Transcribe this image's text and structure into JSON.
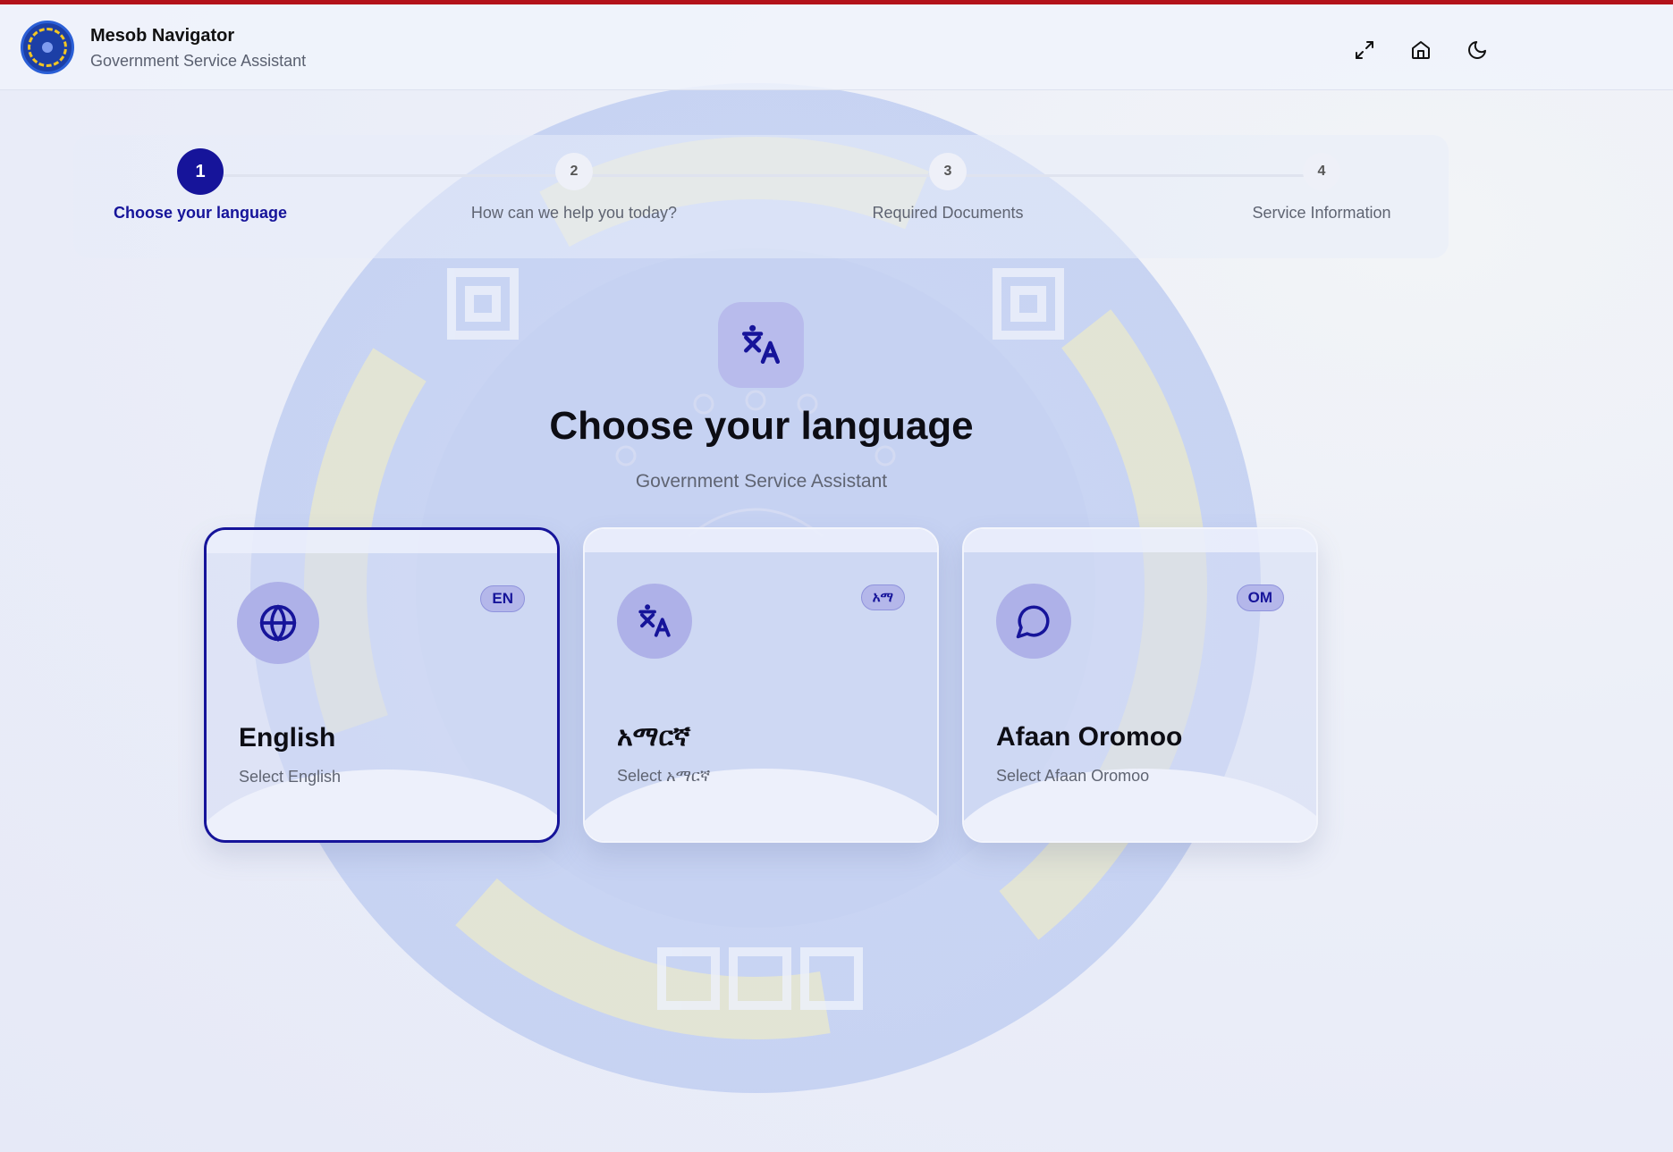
{
  "colors": {
    "accent": "#16149a",
    "top_stripe": "#b3121a",
    "card_icon_bg": "#aeb1e8"
  },
  "header": {
    "app_title": "Mesob Navigator",
    "app_subtitle": "Government Service Assistant",
    "actions": [
      {
        "icon": "expand-icon"
      },
      {
        "icon": "home-icon"
      },
      {
        "icon": "moon-icon"
      }
    ]
  },
  "stepper": {
    "steps": [
      {
        "number": "1",
        "label": "Choose your language",
        "active": true
      },
      {
        "number": "2",
        "label": "How can we help you today?",
        "active": false
      },
      {
        "number": "3",
        "label": "Required Documents",
        "active": false
      },
      {
        "number": "4",
        "label": "Service Information",
        "active": false
      }
    ]
  },
  "hero": {
    "icon": "translate-icon",
    "title": "Choose your language",
    "subtitle": "Government Service Assistant"
  },
  "languages": [
    {
      "name": "English",
      "description": "Select English",
      "badge": "EN",
      "icon": "globe-icon",
      "selected": true
    },
    {
      "name": "አማርኛ",
      "description": "Select አማርኛ",
      "badge": "አማ",
      "icon": "translate-icon",
      "selected": false
    },
    {
      "name": "Afaan Oromoo",
      "description": "Select Afaan Oromoo",
      "badge": "OM",
      "icon": "message-circle-icon",
      "selected": false
    }
  ]
}
